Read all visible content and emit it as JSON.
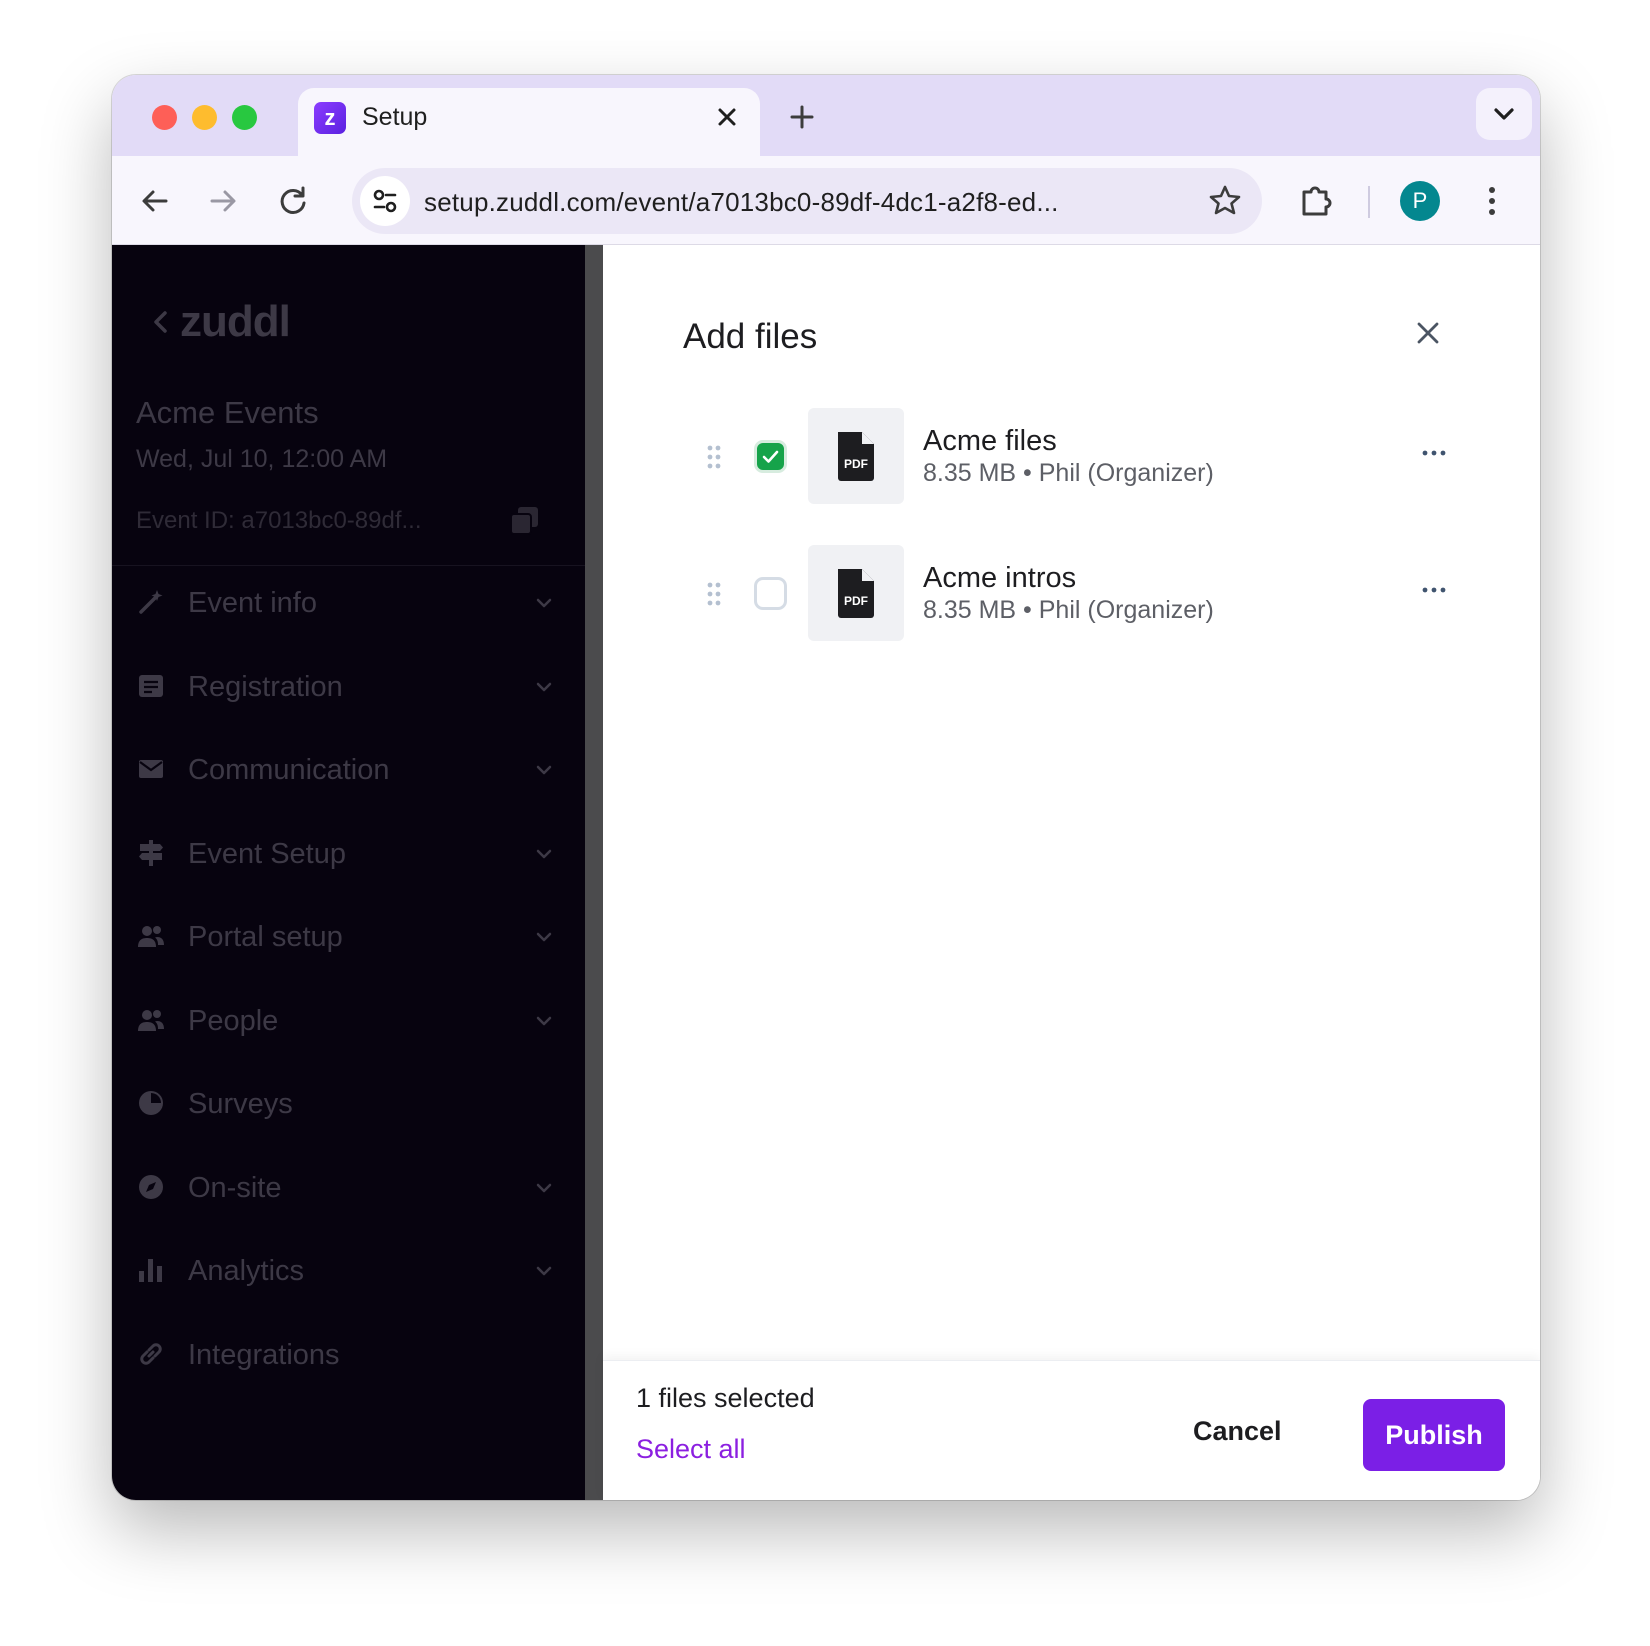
{
  "browser": {
    "tab": {
      "title": "Setup",
      "favicon_letter": "z"
    },
    "url": "setup.zuddl.com/event/a7013bc0-89df-4dc1-a2f8-ed...",
    "profile_initial": "P"
  },
  "sidebar": {
    "logo": "zuddl",
    "event_name": "Acme Events",
    "event_date": "Wed, Jul 10, 12:00 AM",
    "event_id": "Event ID: a7013bc0-89df...",
    "items": [
      {
        "label": "Event info",
        "icon": "magic-wand-icon",
        "has_chevron": true
      },
      {
        "label": "Registration",
        "icon": "form-icon",
        "has_chevron": true
      },
      {
        "label": "Communication",
        "icon": "mail-icon",
        "has_chevron": true
      },
      {
        "label": "Event Setup",
        "icon": "signpost-icon",
        "has_chevron": true
      },
      {
        "label": "Portal setup",
        "icon": "people-icon",
        "has_chevron": true
      },
      {
        "label": "People",
        "icon": "people-icon",
        "has_chevron": true
      },
      {
        "label": "Surveys",
        "icon": "pie-chart-icon",
        "has_chevron": false
      },
      {
        "label": "On-site",
        "icon": "compass-icon",
        "has_chevron": true
      },
      {
        "label": "Analytics",
        "icon": "bar-chart-icon",
        "has_chevron": true
      },
      {
        "label": "Integrations",
        "icon": "link-icon",
        "has_chevron": false
      }
    ]
  },
  "panel": {
    "title": "Add files",
    "files": [
      {
        "name": "Acme files",
        "meta": "8.35 MB • Phil (Organizer)",
        "type": "PDF",
        "checked": true
      },
      {
        "name": "Acme intros",
        "meta": "8.35 MB • Phil (Organizer)",
        "type": "PDF",
        "checked": false
      }
    ],
    "footer": {
      "selected_text": "1 files selected",
      "select_all": "Select all",
      "cancel": "Cancel",
      "publish": "Publish"
    }
  },
  "colors": {
    "accent": "#7b1fe6",
    "check_green": "#16a34a",
    "sidebar_bg": "#07030f",
    "tabstrip_bg": "#e2dbf7"
  }
}
